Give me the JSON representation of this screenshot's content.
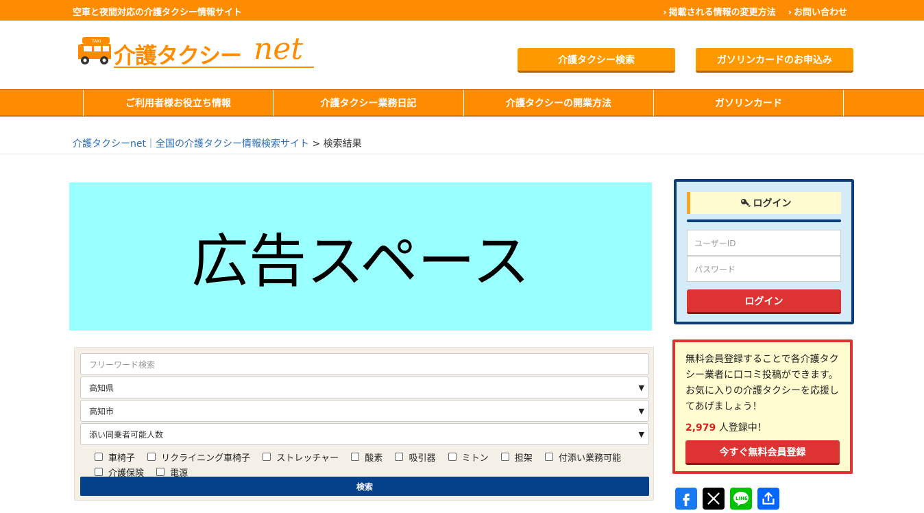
{
  "topbar": {
    "tagline": "空車と夜間対応の介護タクシー情報サイト",
    "links": [
      "掲載される情報の変更方法",
      "お問い合わせ"
    ]
  },
  "header": {
    "logo_text": "介護タクシー",
    "logo_net": "net",
    "logo_icon": "taxi-van-icon",
    "buttons": [
      "介護タクシー検索",
      "ガソリンカードのお申込み"
    ]
  },
  "nav": {
    "items": [
      "ご利用者様お役立ち情報",
      "介護タクシー業務日記",
      "介護タクシーの開業方法",
      "ガソリンカード"
    ]
  },
  "breadcrumb": {
    "home": "介護タクシーnet｜全国の介護タクシー情報検索サイト",
    "separator": ">",
    "current": "検索結果"
  },
  "ad": {
    "label": "広告スペース"
  },
  "search": {
    "freeword_placeholder": "フリーワード検索",
    "prefecture": "高知県",
    "city": "高知市",
    "passengers": "添い同乗者可能人数",
    "options": [
      "車椅子",
      "リクライニング車椅子",
      "ストレッチャー",
      "酸素",
      "吸引器",
      "ミトン",
      "担架",
      "付添い業務可能",
      "介護保険",
      "電源"
    ],
    "button": "検索"
  },
  "login": {
    "title": "ログイン",
    "userid_placeholder": "ユーザーID",
    "password_placeholder": "パスワード",
    "button": "ログイン"
  },
  "register": {
    "description": "無料会員登録することで各介護タクシー業者に口コミ投稿ができます。お気に入りの介護タクシーを応援してあげましょう！",
    "count": "2,979",
    "count_suffix": "人登録中！",
    "button": "今すぐ無料会員登録"
  },
  "share": {
    "icons": [
      "facebook-icon",
      "x-icon",
      "line-icon",
      "share-icon"
    ],
    "line_text": "LINE"
  },
  "colors": {
    "orange": "#ff8c00",
    "navy": "#0b3d78",
    "red": "#dd3333",
    "ad_bg": "#99ffff"
  }
}
